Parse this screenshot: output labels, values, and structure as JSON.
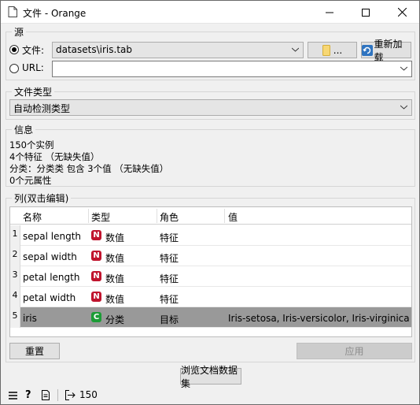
{
  "window": {
    "title": "文件 - Orange"
  },
  "source": {
    "group_title": "源",
    "file_label": "文件:",
    "file_value": "datasets\\iris.tab",
    "browse_label": "...",
    "reload_label": "重新加载",
    "url_label": "URL:",
    "url_value": ""
  },
  "file_type": {
    "group_title": "文件类型",
    "selected": "自动检测类型"
  },
  "info": {
    "group_title": "信息",
    "lines": [
      "150个实例",
      "4个特征 （无缺失值）",
      "分类：分类类 包含 3个值 （无缺失值）",
      "0个元属性"
    ]
  },
  "columns": {
    "group_title": "列(双击编辑)",
    "headers": [
      "名称",
      "类型",
      "角色",
      "值"
    ],
    "rows": [
      {
        "num": "1",
        "name": "sepal length",
        "type_badge": "N",
        "type": "数值",
        "role": "特征",
        "values": ""
      },
      {
        "num": "2",
        "name": "sepal width",
        "type_badge": "N",
        "type": "数值",
        "role": "特征",
        "values": ""
      },
      {
        "num": "3",
        "name": "petal length",
        "type_badge": "N",
        "type": "数值",
        "role": "特征",
        "values": ""
      },
      {
        "num": "4",
        "name": "petal width",
        "type_badge": "N",
        "type": "数值",
        "role": "特征",
        "values": ""
      },
      {
        "num": "5",
        "name": "iris",
        "type_badge": "C",
        "type": "分类",
        "role": "目标",
        "values": "Iris-setosa, Iris-versicolor, Iris-virginica"
      }
    ],
    "reset_label": "重置",
    "apply_label": "应用"
  },
  "browse_docs_label": "浏览文档数据集",
  "status": {
    "output_count": "150"
  },
  "colors": {
    "numeric_badge": "#c0142e",
    "categorical_badge": "#1c9c36",
    "selected_row": "#999999"
  }
}
